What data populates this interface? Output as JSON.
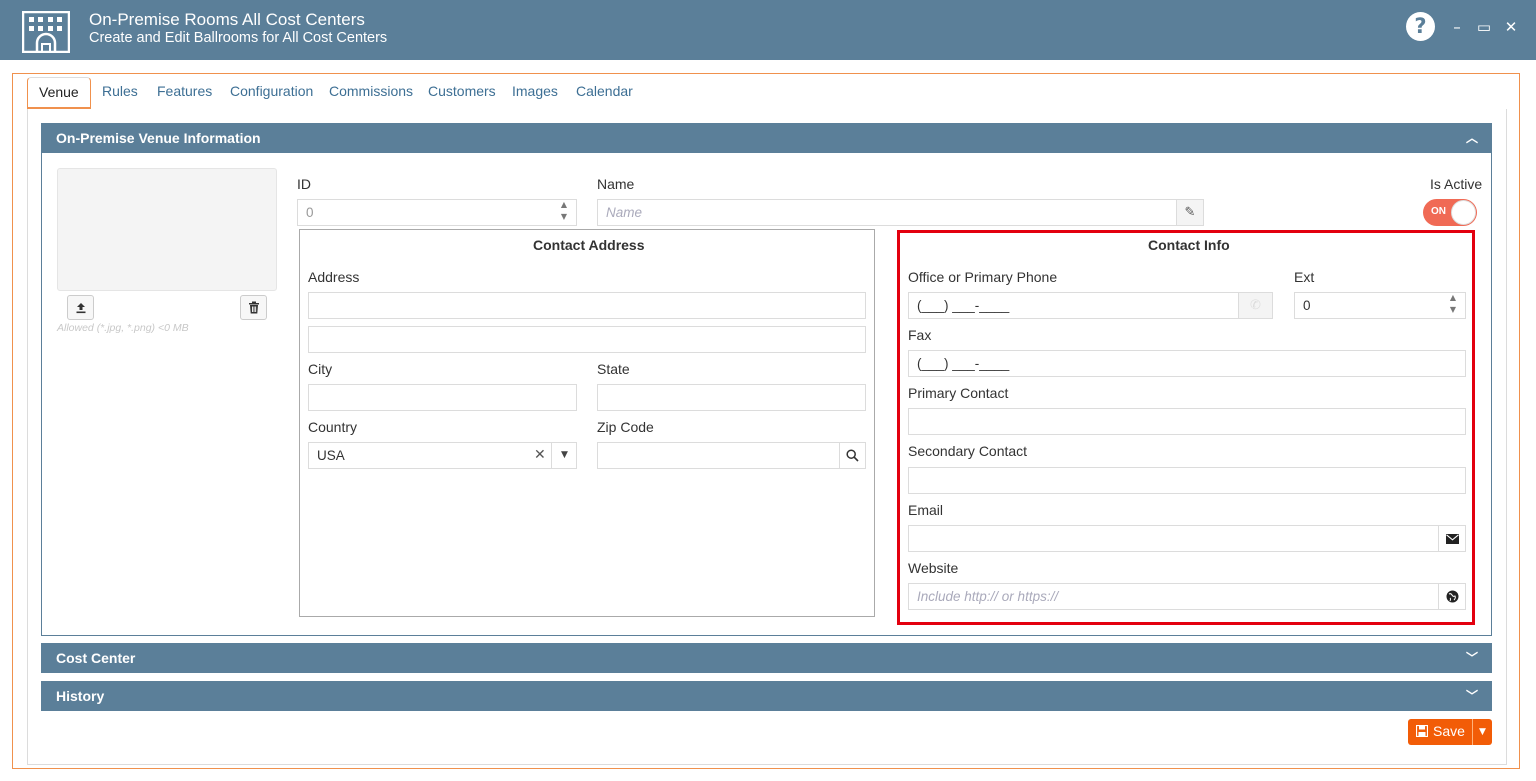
{
  "window": {
    "title": "On-Premise Rooms All Cost Centers",
    "subtitle": "Create and Edit Ballrooms for All Cost Centers",
    "help": "?",
    "minimize": "–",
    "maximize": "▭",
    "close": "✕"
  },
  "tabs": [
    {
      "label": "Venue",
      "active": true
    },
    {
      "label": "Rules"
    },
    {
      "label": "Features"
    },
    {
      "label": "Configuration"
    },
    {
      "label": "Commissions"
    },
    {
      "label": "Customers"
    },
    {
      "label": "Images"
    },
    {
      "label": "Calendar"
    }
  ],
  "venue_section": {
    "title": "On-Premise Venue Information",
    "allowed_text": "Allowed (*.jpg, *.png) <0 MB",
    "id_label": "ID",
    "id_value": "0",
    "name_label": "Name",
    "name_placeholder": "Name",
    "is_active_label": "Is Active",
    "is_active_value": "ON"
  },
  "contact_address": {
    "title": "Contact Address",
    "address_label": "Address",
    "city_label": "City",
    "state_label": "State",
    "country_label": "Country",
    "country_value": "USA",
    "zip_label": "Zip Code"
  },
  "contact_info": {
    "title": "Contact Info",
    "phone_label": "Office or Primary Phone",
    "phone_value": "(___) ___-____",
    "ext_label": "Ext",
    "ext_value": "0",
    "fax_label": "Fax",
    "fax_value": "(___) ___-____",
    "primary_contact_label": "Primary Contact",
    "secondary_contact_label": "Secondary Contact",
    "email_label": "Email",
    "website_label": "Website",
    "website_placeholder": "Include http:// or https://"
  },
  "sections": {
    "cost_center": "Cost Center",
    "history": "History"
  },
  "save_button": {
    "label": "Save"
  },
  "colors": {
    "header": "#5b7f99",
    "accent": "#f25c07",
    "toggle_on": "#f06a55",
    "highlight": "#e3000f"
  }
}
